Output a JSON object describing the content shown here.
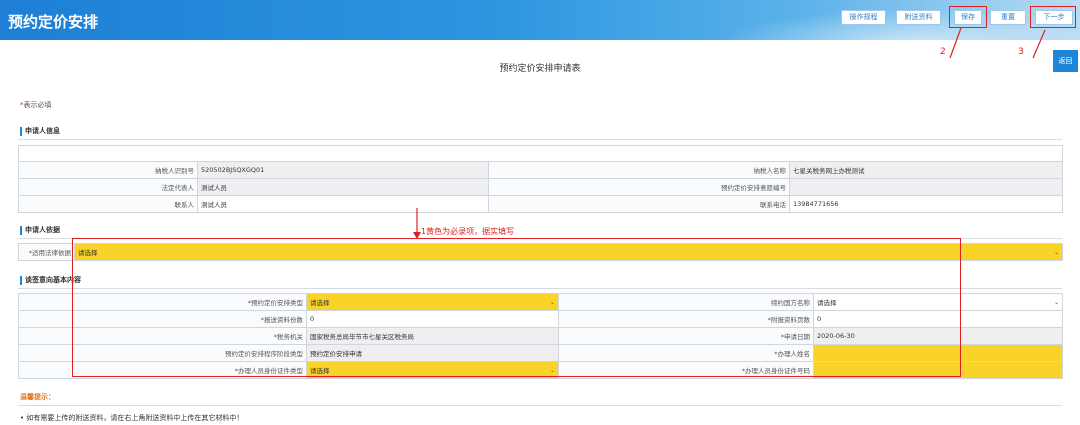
{
  "header": {
    "title": "预约定价安排",
    "buttons": {
      "operation_guide": "操作规程",
      "attachment": "附送资料",
      "save": "保存",
      "reset": "重置",
      "next": "下一步"
    }
  },
  "annotations": {
    "save_marker": "2",
    "next_marker": "3",
    "required_marker": "1黄色为必录项，据实填写"
  },
  "back_button": "返回",
  "form_title": "预约定价安排申请表",
  "required_note": {
    "star": "*",
    "text": "表示必填"
  },
  "sections": {
    "applicant_info": "申请人信息",
    "applicant_basis": "申请人依据",
    "intent_content": "谈签意向基本内容"
  },
  "applicant_info": {
    "taxpayer_id_label": "纳税人识别号",
    "taxpayer_id": "520502BJSQXGQ01",
    "taxpayer_name_label": "纳税人名称",
    "taxpayer_name": "七星关税务网上办税测试",
    "legal_rep_label": "法定代表人",
    "legal_rep": "测试人员",
    "apa_code_label": "预约定价安排意愿编号",
    "apa_code": "",
    "contact_label": "联系人",
    "contact": "测试人员",
    "phone_label": "联系电话",
    "phone": "13984771656"
  },
  "applicant_basis": {
    "law_label": "*适用法律依据",
    "law_value": "请选择"
  },
  "intent_content": {
    "apa_type_label": "*预约定价安排类型",
    "apa_type_value": "请选择",
    "country_label": "缔约国方名称",
    "country_value": "请选择",
    "submit_copies_label": "*报送资料份数",
    "submit_copies_value": "0",
    "attach_pages_label": "*附报资料页数",
    "attach_pages_value": "0",
    "tax_office_label": "*税务机关",
    "tax_office_value": "国家税务总局毕节市七星关区税务局",
    "apply_date_label": "*申请日期",
    "apply_date_value": "2020-06-30",
    "stage_label": "预约定价安排程序阶段类型",
    "stage_value": "预约定价安排申请",
    "handler_name_label": "*办理人姓名",
    "handler_name_value": "",
    "id_type_label": "*办理人员身份证件类型",
    "id_type_value": "请选择",
    "id_no_label": "*办理人员身份证件号码",
    "id_no_value": ""
  },
  "tips": {
    "title": "温馨提示：",
    "line": "•  如有需要上传的附送资料，请在右上角附送资料中上传在其它材料中！"
  },
  "colors": {
    "header": "#1e7fd4",
    "required_fill": "#f9d327",
    "annotation": "#e02020",
    "tip": "#e8761c"
  }
}
